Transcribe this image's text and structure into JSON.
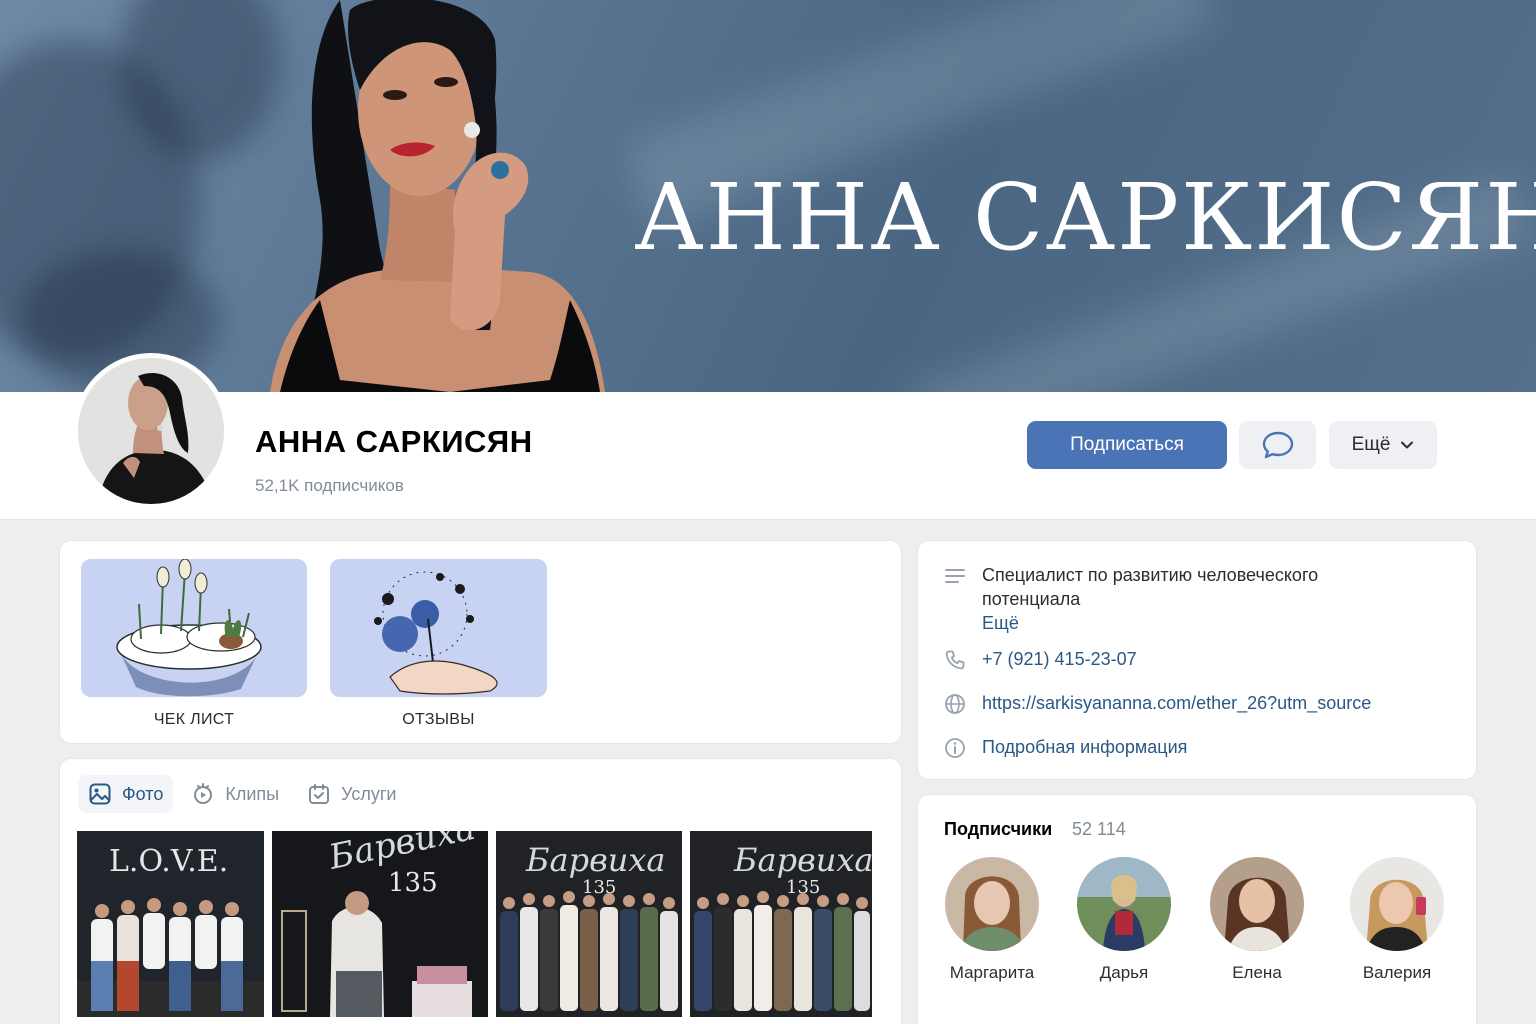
{
  "cover": {
    "title": "АННА САРКИСЯН"
  },
  "profile": {
    "name": "АННА САРКИСЯН",
    "subscribers": "52,1K подписчиков",
    "subscribe_label": "Подписаться",
    "more_label": "Ещё"
  },
  "stories": [
    {
      "label": "ЧЕК ЛИСТ"
    },
    {
      "label": "ОТЗЫВЫ"
    }
  ],
  "media": {
    "tabs": [
      {
        "label": "Фото",
        "icon": "image-icon"
      },
      {
        "label": "Клипы",
        "icon": "clips-icon"
      },
      {
        "label": "Услуги",
        "icon": "services-icon"
      }
    ],
    "photos": [
      {
        "sign": "L.O.V.E."
      },
      {
        "sign": "Барвиха",
        "number": "135"
      },
      {
        "sign": "Барвиха",
        "number": "135"
      },
      {
        "sign": "Барвиха",
        "number": "135"
      }
    ]
  },
  "info": {
    "description_line1": "Специалист по развитию человеческого",
    "description_line2": "потенциала",
    "more": "Ещё",
    "phone": "+7 (921) 415-23-07",
    "website": "https://sarkisyananna.com/ether_26?utm_source",
    "details": "Подробная информация"
  },
  "subscribers": {
    "title": "Подписчики",
    "count": "52 114",
    "people": [
      {
        "name": "Маргарита"
      },
      {
        "name": "Дарья"
      },
      {
        "name": "Елена"
      },
      {
        "name": "Валерия"
      }
    ]
  },
  "colors": {
    "accent": "#4a74b5",
    "link": "#2a5885",
    "cover": "#57738f",
    "page_bg": "#edeef0"
  }
}
